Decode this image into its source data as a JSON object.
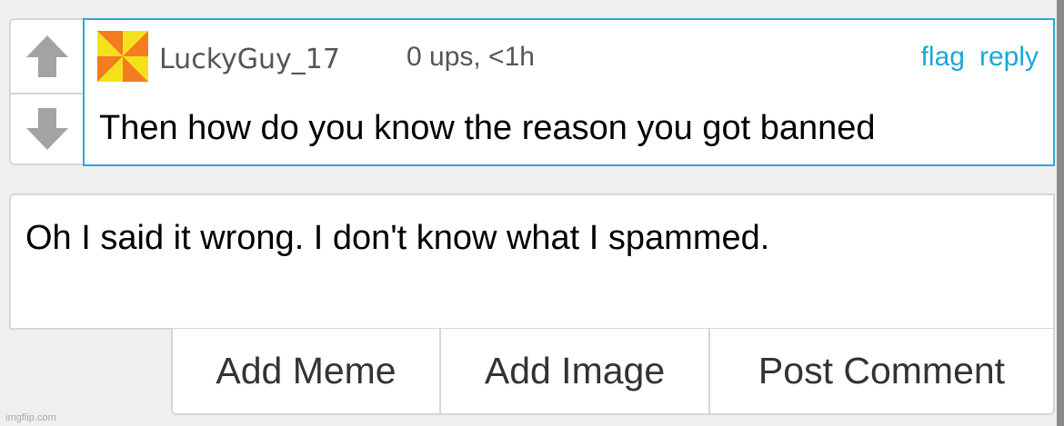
{
  "comment": {
    "username": "LuckyGuy_17",
    "meta": "0 ups, <1h",
    "actions": {
      "flag": "flag",
      "reply": "reply"
    },
    "text": "Then how do you know the reason you got banned",
    "avatar_icon": "pinwheel-avatar-icon",
    "colors": {
      "accent": "#2aabd2",
      "link": "#1aa7d8",
      "avatar_orange": "#f47c20",
      "avatar_yellow": "#f5e11b"
    }
  },
  "votes": {
    "up_icon": "arrow-up-icon",
    "down_icon": "arrow-down-icon"
  },
  "reply_box": {
    "value": "Oh I said it wrong. I don't know what I spammed."
  },
  "buttons": {
    "add_meme": "Add Meme",
    "add_image": "Add Image",
    "post_comment": "Post Comment"
  },
  "watermark": "imgflip.com"
}
